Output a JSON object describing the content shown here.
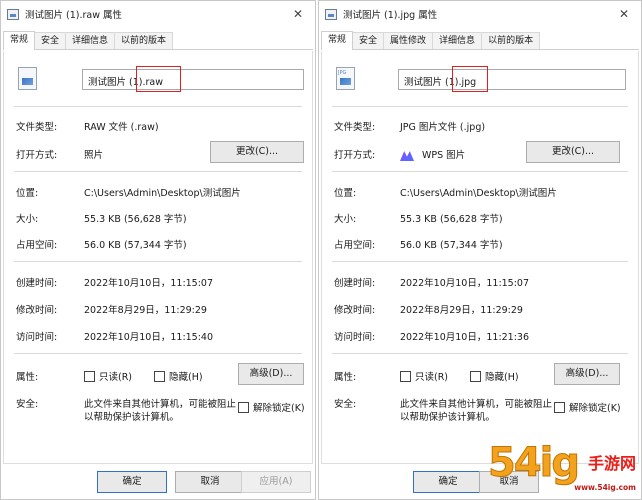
{
  "left": {
    "title": "测试图片 (1).raw 属性",
    "tabs": [
      "常规",
      "安全",
      "详细信息",
      "以前的版本"
    ],
    "filename": "测试图片 (1).raw",
    "type_label": "文件类型:",
    "type_value": "RAW 文件 (.raw)",
    "open_label": "打开方式:",
    "open_value": "照片",
    "change_btn": "更改(C)...",
    "location_label": "位置:",
    "location_value": "C:\\Users\\Admin\\Desktop\\测试图片",
    "size_label": "大小:",
    "size_value": "55.3 KB (56,628 字节)",
    "disk_label": "占用空间:",
    "disk_value": "56.0 KB (57,344 字节)",
    "created_label": "创建时间:",
    "created_value": "2022年10月10日，11:15:07",
    "modified_label": "修改时间:",
    "modified_value": "2022年8月29日，11:29:29",
    "accessed_label": "访问时间:",
    "accessed_value": "2022年10月10日，11:15:40",
    "attr_label": "属性:",
    "readonly": "只读(R)",
    "hidden": "隐藏(H)",
    "advanced": "高级(D)...",
    "security_label": "安全:",
    "security_text_1": "此文件来自其他计算机，可能被阻止",
    "security_text_2": "以帮助保护该计算机。",
    "unblock": "解除锁定(K)",
    "ok": "确定",
    "cancel": "取消",
    "apply": "应用(A)"
  },
  "right": {
    "title": "测试图片 (1).jpg 属性",
    "tabs": [
      "常规",
      "安全",
      "属性修改",
      "详细信息",
      "以前的版本"
    ],
    "filename": "测试图片 (1).jpg",
    "type_label": "文件类型:",
    "type_value": "JPG 图片文件 (.jpg)",
    "open_label": "打开方式:",
    "open_value": "WPS 图片",
    "change_btn": "更改(C)...",
    "location_label": "位置:",
    "location_value": "C:\\Users\\Admin\\Desktop\\测试图片",
    "size_label": "大小:",
    "size_value": "55.3 KB (56,628 字节)",
    "disk_label": "占用空间:",
    "disk_value": "56.0 KB (57,344 字节)",
    "created_label": "创建时间:",
    "created_value": "2022年10月10日，11:15:07",
    "modified_label": "修改时间:",
    "modified_value": "2022年8月29日，11:29:29",
    "accessed_label": "访问时间:",
    "accessed_value": "2022年10月10日，11:21:36",
    "attr_label": "属性:",
    "readonly": "只读(R)",
    "hidden": "隐藏(H)",
    "advanced": "高级(D)...",
    "security_label": "安全:",
    "security_text_1": "此文件来自其他计算机，可能被阻止",
    "security_text_2": "以帮助保护该计算机。",
    "unblock": "解除锁定(K)",
    "ok": "确定",
    "cancel": "取消"
  },
  "watermark": {
    "big": "54ig",
    "small": "手游网",
    "url": "www.54ig.com"
  },
  "colors": {
    "highlight": "#e02020",
    "accent": "#2f6fd0"
  }
}
